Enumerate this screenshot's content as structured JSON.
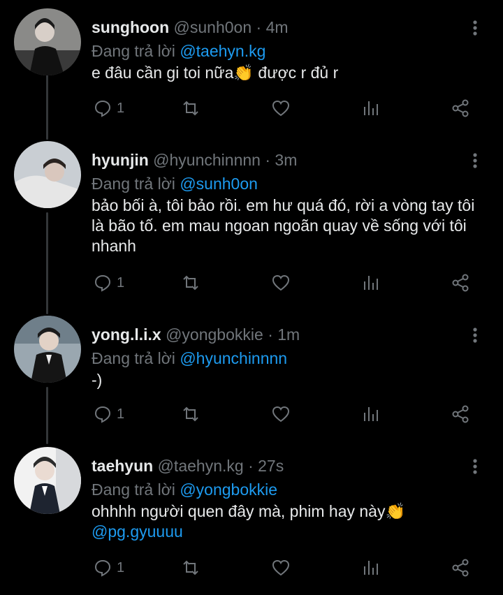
{
  "tweets": [
    {
      "name": "sunghoon",
      "handle": "@sunh0on",
      "time": "4m",
      "replying_label": "Đang trả lời",
      "replying_to": "@taehyn.kg",
      "text": "e đâu cần gi toi nữa",
      "text_after": " được r đủ r",
      "mention": "",
      "reply_count": "1"
    },
    {
      "name": "hyunjin",
      "handle": "@hyunchinnnn",
      "time": "3m",
      "replying_label": "Đang trả lời",
      "replying_to": "@sunh0on",
      "text": "bảo bối à, tôi bảo rồi. em hư quá đó, rời a vòng tay tôi là bão tố. em mau ngoan ngoãn quay về sống với tôi nhanh",
      "text_after": "",
      "mention": "",
      "reply_count": "1"
    },
    {
      "name": "yong.l.i.x",
      "handle": "@yongbokkie",
      "time": "1m",
      "replying_label": "Đang trả lời",
      "replying_to": "@hyunchinnnn",
      "text": "-)",
      "text_after": "",
      "mention": "",
      "reply_count": "1"
    },
    {
      "name": "taehyun",
      "handle": "@taehyn.kg",
      "time": "27s",
      "replying_label": "Đang trả lời",
      "replying_to": "@yongbokkie",
      "text": "ohhhh người quen đây mà, phim hay này",
      "text_after": "",
      "mention": "@pg.gyuuuu",
      "reply_count": "1"
    }
  ],
  "icons": {
    "reply": "reply-icon",
    "retweet": "retweet-icon",
    "like": "heart-icon",
    "views": "analytics-icon",
    "share": "share-icon",
    "more": "more-vertical-icon",
    "emoji": "clapping-hands-emoji"
  },
  "colors": {
    "background": "#000000",
    "text": "#e7e9ea",
    "muted": "#71767b",
    "link": "#1d9bf0"
  }
}
